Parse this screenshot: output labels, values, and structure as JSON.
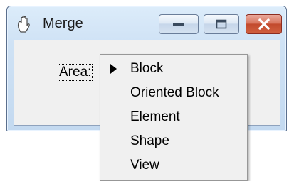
{
  "window": {
    "title": "Merge",
    "controls": {
      "minimize_icon": "minimize-icon",
      "maximize_icon": "restore-icon",
      "close_icon": "close-icon"
    },
    "close_color": "#c24a2d"
  },
  "form": {
    "area_label": "Area:"
  },
  "menu": {
    "items": [
      {
        "label": "Block",
        "checked": true
      },
      {
        "label": "Oriented Block",
        "checked": false
      },
      {
        "label": "Element",
        "checked": false
      },
      {
        "label": "Shape",
        "checked": false
      },
      {
        "label": "View",
        "checked": false
      }
    ]
  }
}
